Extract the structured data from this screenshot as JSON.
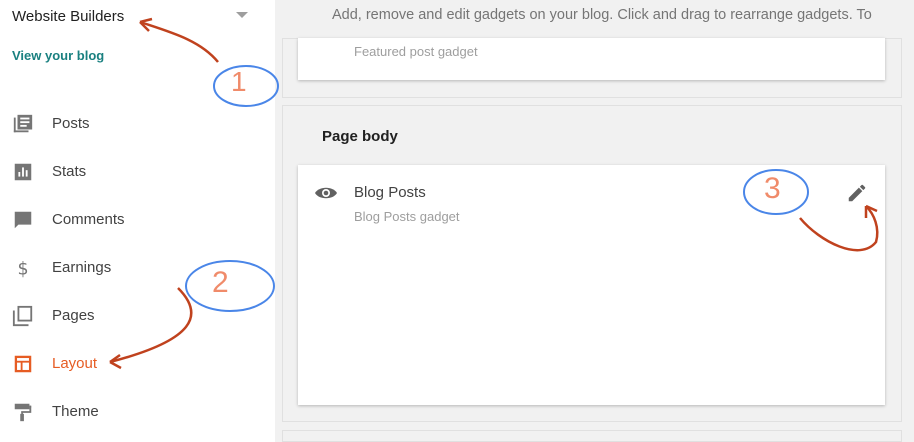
{
  "sidebar": {
    "blog_name": "Website Builders",
    "view_blog": "View your blog",
    "items": [
      {
        "label": "Posts",
        "icon": "posts-icon"
      },
      {
        "label": "Stats",
        "icon": "stats-icon"
      },
      {
        "label": "Comments",
        "icon": "comments-icon"
      },
      {
        "label": "Earnings",
        "icon": "earnings-icon"
      },
      {
        "label": "Pages",
        "icon": "pages-icon"
      },
      {
        "label": "Layout",
        "icon": "layout-icon"
      },
      {
        "label": "Theme",
        "icon": "theme-icon"
      }
    ]
  },
  "main": {
    "hint": "Add, remove and edit gadgets on your blog. Click and drag to rearrange gadgets. To"
  },
  "featured": {
    "subtitle": "Featured post gadget"
  },
  "page_body": {
    "title": "Page body",
    "gadget_title": "Blog Posts",
    "gadget_subtitle": "Blog Posts gadget"
  },
  "annotations": {
    "n1": "1",
    "n2": "2",
    "n3": "3"
  },
  "colors": {
    "accent": "#e65c23",
    "link": "#1a8080",
    "annotation_circle": "#4a86e8",
    "annotation_number": "#f08b6a",
    "annotation_arrow": "#c0421e"
  }
}
